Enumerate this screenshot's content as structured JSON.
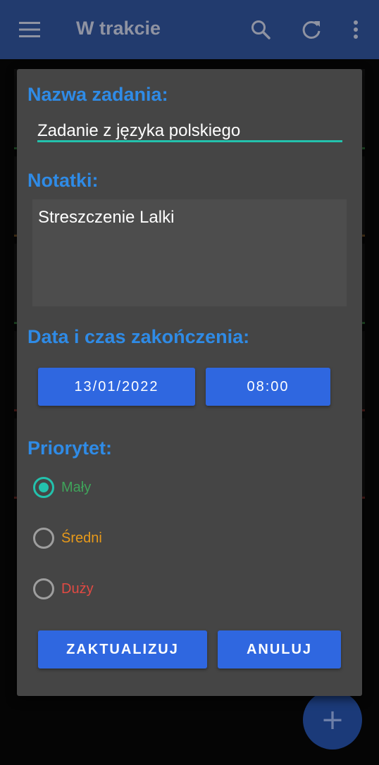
{
  "app_bar": {
    "title": "W trakcie",
    "icons": [
      "menu-icon",
      "search-icon",
      "refresh-icon",
      "more-vert-icon"
    ],
    "background": "#223b6e"
  },
  "dialog": {
    "name_label": "Nazwa zadania:",
    "name_value": "Zadanie z języka polskiego",
    "notes_label": "Notatki:",
    "notes_value": "Streszczenie Lalki",
    "date_label": "Data i czas zakończenia:",
    "date_button": "13/01/2022",
    "time_button": "08:00",
    "priority_label": "Priorytet:",
    "priorities": [
      {
        "label": "Mały",
        "color": "#3fa35a",
        "selected": true
      },
      {
        "label": "Średni",
        "color": "#e89a1a",
        "selected": false
      },
      {
        "label": "Duży",
        "color": "#e14a43",
        "selected": false
      }
    ],
    "update_button": "ZAKTUALIZUJ",
    "cancel_button": "ANULUJ"
  },
  "fab": {
    "icon": "plus-icon",
    "label": "+"
  },
  "colors": {
    "accent": "#2f8be6",
    "button": "#2f67e0",
    "teal": "#23c2ad",
    "dialog_bg": "#454545"
  }
}
